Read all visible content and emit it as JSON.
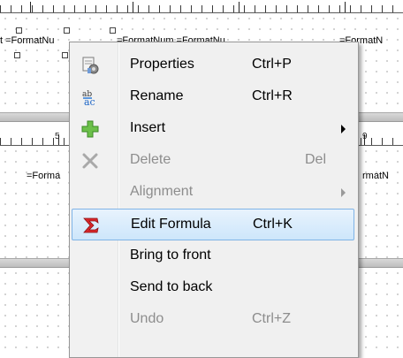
{
  "designer": {
    "fields_top": [
      "t =FormatNu",
      "=FormatNum =FormatNu",
      "=FormatN"
    ],
    "fields_mid": [
      "=Forma",
      "rmatN"
    ],
    "ruler_labels": [
      "5",
      "9"
    ]
  },
  "context_menu": {
    "items": [
      {
        "label": "Properties",
        "shortcut": "Ctrl+P",
        "icon": "properties-icon",
        "enabled": true
      },
      {
        "label": "Rename",
        "shortcut": "Ctrl+R",
        "icon": "rename-icon",
        "enabled": true
      },
      {
        "label": "Insert",
        "shortcut": "",
        "icon": "insert-plus-icon",
        "enabled": true,
        "submenu": true
      },
      {
        "label": "Delete",
        "shortcut": "Del",
        "icon": "delete-x-icon",
        "enabled": false
      },
      {
        "label": "Alignment",
        "shortcut": "",
        "icon": "",
        "enabled": false,
        "submenu": true
      },
      {
        "label": "Edit Formula",
        "shortcut": "Ctrl+K",
        "icon": "formula-sigma-icon",
        "enabled": true,
        "highlighted": true
      },
      {
        "label": "Bring to front",
        "shortcut": "",
        "icon": "",
        "enabled": true
      },
      {
        "label": "Send to back",
        "shortcut": "",
        "icon": "",
        "enabled": true
      },
      {
        "label": "Undo",
        "shortcut": "Ctrl+Z",
        "icon": "",
        "enabled": false
      }
    ]
  },
  "colors": {
    "highlight_fill": "#cde6fb",
    "highlight_border": "#7fb3e6",
    "menu_bg": "#f0f0f0",
    "disabled_text": "#8d8d8d"
  }
}
